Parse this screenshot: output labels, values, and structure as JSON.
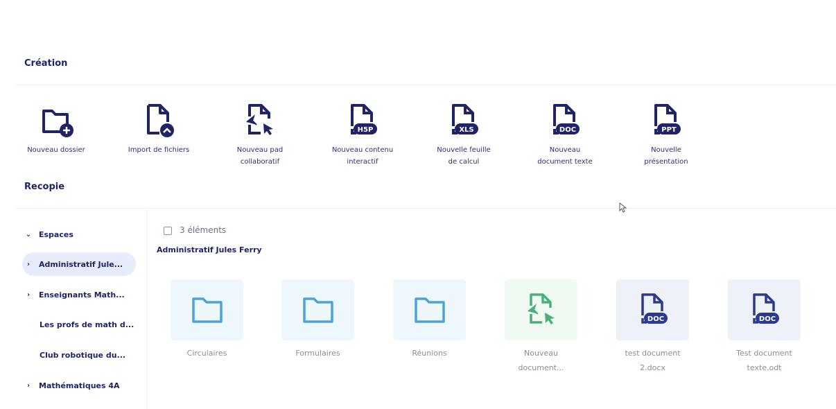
{
  "creation": {
    "title": "Création",
    "items": [
      {
        "label_1": "Nouveau dossier",
        "label_2": "",
        "icon": "new-folder-icon"
      },
      {
        "label_1": "Import de fichiers",
        "label_2": "",
        "icon": "import-file-icon"
      },
      {
        "label_1": "Nouveau pad",
        "label_2": "collaboratif",
        "icon": "collaborative-pad-icon"
      },
      {
        "label_1": "Nouveau contenu",
        "label_2": "interactif",
        "icon": "h5p-file-icon",
        "badge": "H5P"
      },
      {
        "label_1": "Nouvelle feuille",
        "label_2": "de calcul",
        "icon": "xls-file-icon",
        "badge": "XLS"
      },
      {
        "label_1": "Nouveau",
        "label_2": "document texte",
        "icon": "doc-file-icon",
        "badge": "DOC"
      },
      {
        "label_1": "Nouvelle",
        "label_2": "présentation",
        "icon": "ppt-file-icon",
        "badge": "PPT"
      }
    ]
  },
  "recopie": {
    "title": "Recopie"
  },
  "sidebar": {
    "items": [
      {
        "label": "Espaces",
        "chevron": "⌄"
      },
      {
        "label": "Administratif Jule...",
        "chevron": "›"
      },
      {
        "label": "Enseignants Math...",
        "chevron": "›"
      },
      {
        "label": "Les profs de math d...",
        "chevron": ""
      },
      {
        "label": "Club robotique du...",
        "chevron": ""
      },
      {
        "label": "Mathématiques 4A",
        "chevron": "›"
      }
    ]
  },
  "main": {
    "count": "3 éléments",
    "breadcrumb": "Administratif Jules Ferry",
    "tiles": [
      {
        "name_1": "Circulaires",
        "name_2": "",
        "kind": "folder"
      },
      {
        "name_1": "Formulaires",
        "name_2": "",
        "kind": "folder"
      },
      {
        "name_1": "Réunions",
        "name_2": "",
        "kind": "folder"
      },
      {
        "name_1": "Nouveau",
        "name_2": "document...",
        "kind": "pad"
      },
      {
        "name_1": "test document",
        "name_2": "2.docx",
        "kind": "doc",
        "badge": "DOC"
      },
      {
        "name_1": "Test document",
        "name_2": "texte.odt",
        "kind": "doc",
        "badge": "DOC"
      }
    ]
  },
  "colors": {
    "navy": "#1e2466",
    "folder_blue": "#4aa3d8",
    "pad_green": "#4caf7a",
    "doc_navy": "#2b3a8f"
  }
}
